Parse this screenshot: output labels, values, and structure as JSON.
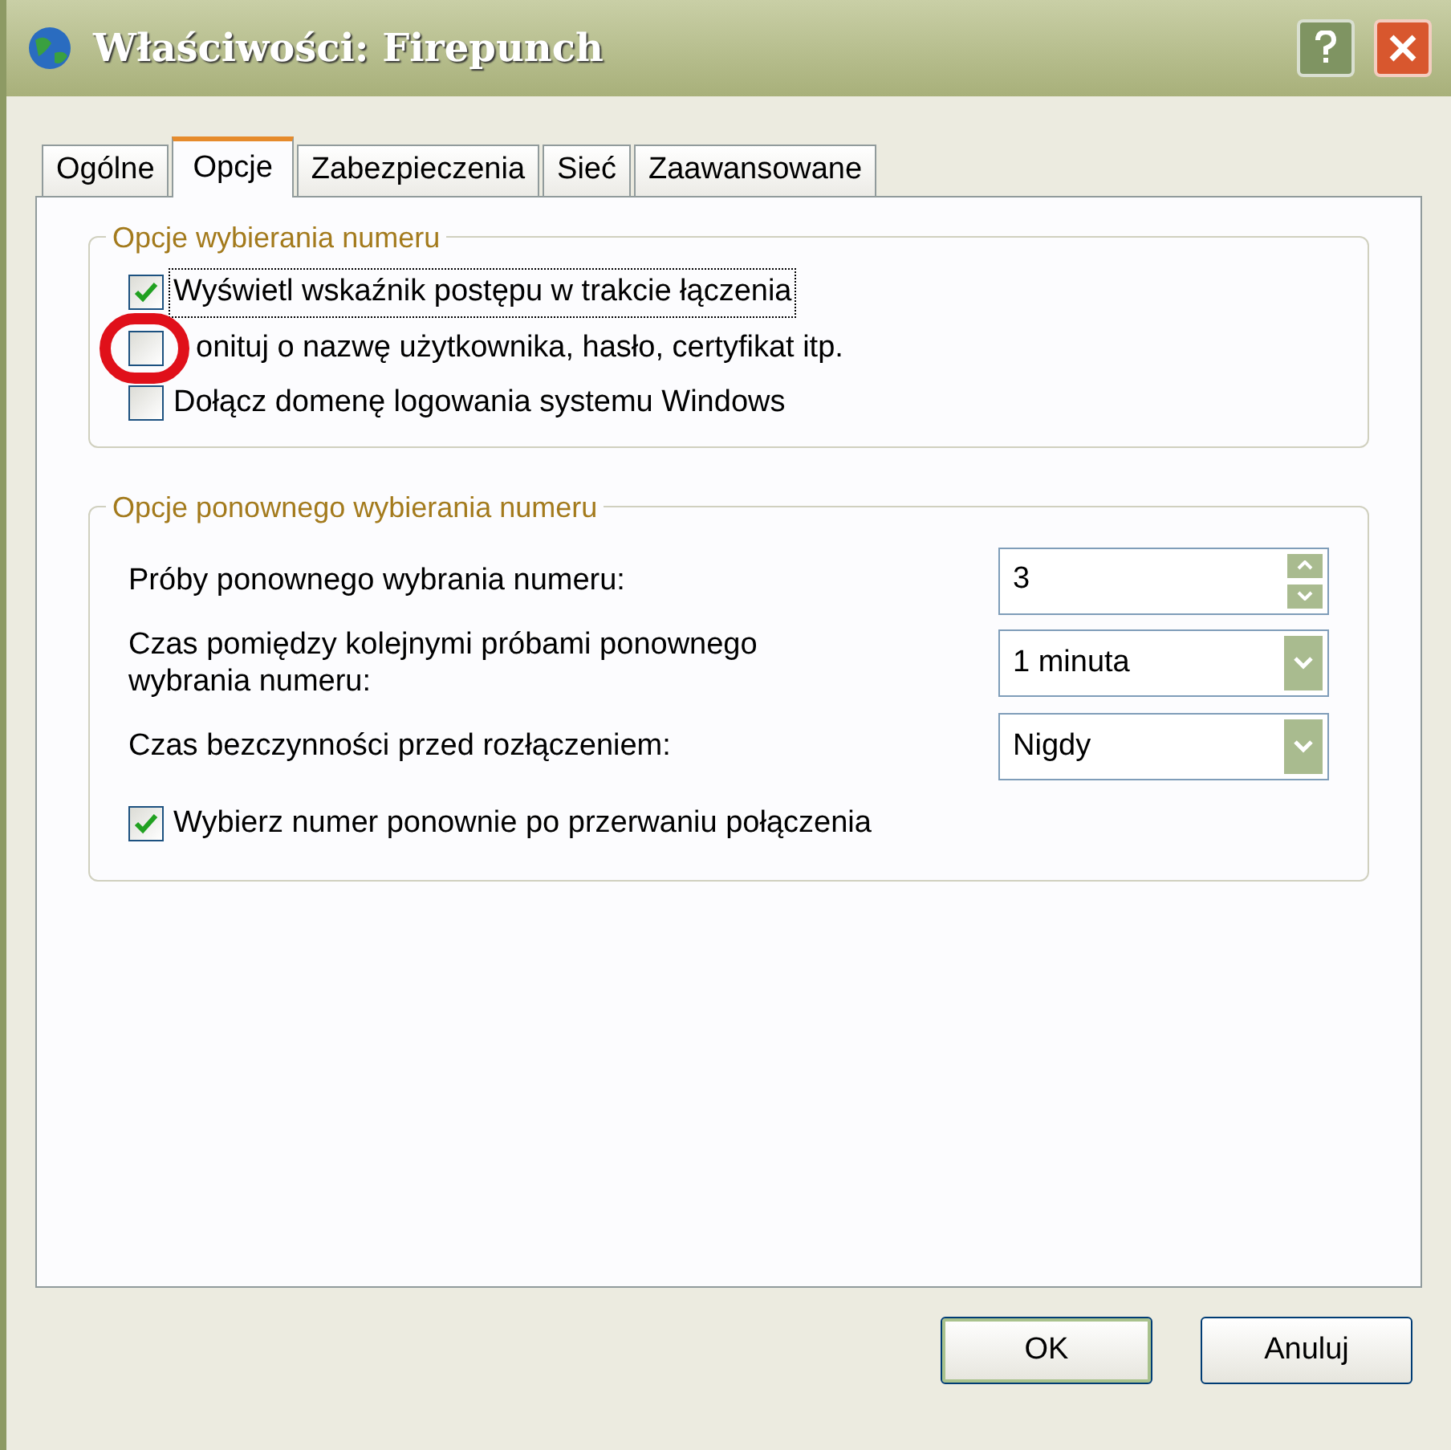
{
  "window": {
    "title": "Właściwości: Firepunch"
  },
  "tabs": [
    {
      "label": "Ogólne",
      "selected": false
    },
    {
      "label": "Opcje",
      "selected": true
    },
    {
      "label": "Zabezpieczenia",
      "selected": false
    },
    {
      "label": "Sieć",
      "selected": false
    },
    {
      "label": "Zaawansowane",
      "selected": false
    }
  ],
  "dialing_group": {
    "title": "Opcje wybierania numeru",
    "options": [
      {
        "label": "Wyświetl wskaźnik postępu w trakcie łączenia",
        "checked": true,
        "focused": true,
        "highlighted": false
      },
      {
        "label": "onituj o nazwę użytkownika, hasło, certyfikat itp.",
        "checked": false,
        "focused": false,
        "highlighted": true
      },
      {
        "label": "Dołącz domenę logowania systemu Windows",
        "checked": false,
        "focused": false,
        "highlighted": false
      }
    ]
  },
  "redial_group": {
    "title": "Opcje ponownego wybierania numeru",
    "fields": [
      {
        "kind": "spinner",
        "label": "Próby ponownego wybrania numeru:",
        "value": "3"
      },
      {
        "kind": "dropdown",
        "label": "Czas pomiędzy kolejnymi próbami ponownego wybrania numeru:",
        "value": "1 minuta"
      },
      {
        "kind": "dropdown",
        "label": "Czas bezczynności przed rozłączeniem:",
        "value": "Nigdy"
      }
    ],
    "option": {
      "label": "Wybierz numer ponownie po przerwaniu połączenia",
      "checked": true
    }
  },
  "buttons": [
    {
      "label": "OK",
      "default": true
    },
    {
      "label": "Anuluj",
      "default": false
    }
  ]
}
